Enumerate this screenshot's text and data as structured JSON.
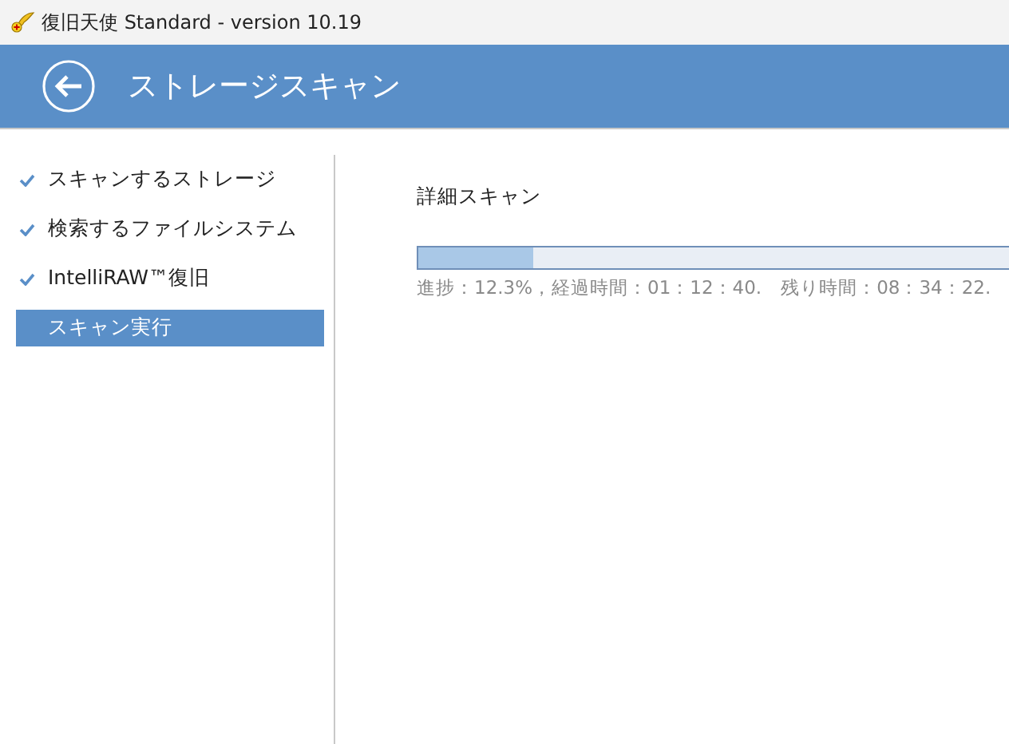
{
  "window": {
    "title": "復旧天使 Standard - version 10.19"
  },
  "header": {
    "title": "ストレージスキャン"
  },
  "steps": [
    {
      "label": "スキャンするストレージ",
      "checked": true,
      "selected": false
    },
    {
      "label": "検索するファイルシステム",
      "checked": true,
      "selected": false
    },
    {
      "label": "IntelliRAW™復旧",
      "checked": true,
      "selected": false
    },
    {
      "label": "スキャン実行",
      "checked": false,
      "selected": true
    }
  ],
  "scan": {
    "title": "詳細スキャン",
    "level": 0.123,
    "status": "進捗：12.3%，経過時間：01：12：40.　残り時間：08：34：22."
  }
}
